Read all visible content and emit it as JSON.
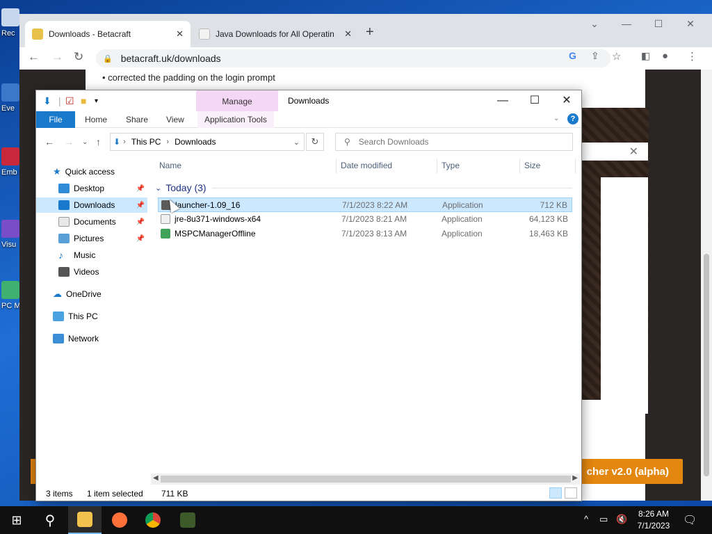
{
  "desktop": {
    "icons": [
      {
        "label": "Rec",
        "icon": "recycle-bin-icon"
      },
      {
        "label": "Eve",
        "icon": "app-shortcut-icon"
      },
      {
        "label": "Emb De",
        "icon": "app-shortcut-icon"
      },
      {
        "label": "Visu",
        "icon": "app-shortcut-icon"
      },
      {
        "label": "PC M",
        "icon": "app-shortcut-icon"
      }
    ]
  },
  "browser": {
    "tabs": [
      {
        "label": "Downloads - Betacraft",
        "icon": "betacraft-favicon",
        "active": true
      },
      {
        "label": "Java Downloads for All Operatin",
        "icon": "java-favicon",
        "active": false
      }
    ],
    "url": "betacraft.uk/downloads",
    "page": {
      "changelog_lines": [
        "• corrected the padding on the login prompt"
      ],
      "launcher_button": "cher v2.0 (alpha)"
    }
  },
  "explorer": {
    "title": "Downloads",
    "manage_label": "Manage",
    "ribbon_tabs": [
      "File",
      "Home",
      "Share",
      "View",
      "Application Tools"
    ],
    "breadcrumb": [
      "This PC",
      "Downloads"
    ],
    "search_placeholder": "Search Downloads",
    "nav": [
      {
        "label": "Quick access",
        "icon": "star-icon",
        "pinned": false
      },
      {
        "label": "Desktop",
        "icon": "desktop-folder-icon",
        "pinned": true
      },
      {
        "label": "Downloads",
        "icon": "downloads-folder-icon",
        "pinned": true,
        "selected": true
      },
      {
        "label": "Documents",
        "icon": "documents-folder-icon",
        "pinned": true
      },
      {
        "label": "Pictures",
        "icon": "pictures-folder-icon",
        "pinned": true
      },
      {
        "label": "Music",
        "icon": "music-folder-icon",
        "pinned": false
      },
      {
        "label": "Videos",
        "icon": "videos-folder-icon",
        "pinned": false
      },
      {
        "label": "OneDrive",
        "icon": "onedrive-icon",
        "pinned": false
      },
      {
        "label": "This PC",
        "icon": "this-pc-icon",
        "pinned": false
      },
      {
        "label": "Network",
        "icon": "network-icon",
        "pinned": false
      }
    ],
    "columns": [
      "Name",
      "Date modified",
      "Type",
      "Size"
    ],
    "group_label": "Today (3)",
    "files": [
      {
        "name": "launcher-1.09_16",
        "date": "7/1/2023 8:22 AM",
        "type": "Application",
        "size": "712 KB",
        "selected": true,
        "icon": "minecraft-launcher-icon"
      },
      {
        "name": "jre-8u371-windows-x64",
        "date": "7/1/2023 8:21 AM",
        "type": "Application",
        "size": "64,123 KB",
        "selected": false,
        "icon": "java-installer-icon"
      },
      {
        "name": "MSPCManagerOffline",
        "date": "7/1/2023 8:13 AM",
        "type": "Application",
        "size": "18,463 KB",
        "selected": false,
        "icon": "installer-icon"
      }
    ],
    "status": {
      "count": "3 items",
      "selection": "1 item selected",
      "size": "711 KB"
    }
  },
  "taskbar": {
    "items": [
      "start-icon",
      "search-icon",
      "file-explorer-icon",
      "firefox-icon",
      "chrome-icon",
      "minecraft-icon"
    ],
    "time": "8:26 AM",
    "date": "7/1/2023",
    "notification_count": "1"
  },
  "colors": {
    "selection": "#cce8ff",
    "manage_tab": "#f4d6f5",
    "file_tab": "#1979ca",
    "launcher_button": "#e4870f"
  }
}
